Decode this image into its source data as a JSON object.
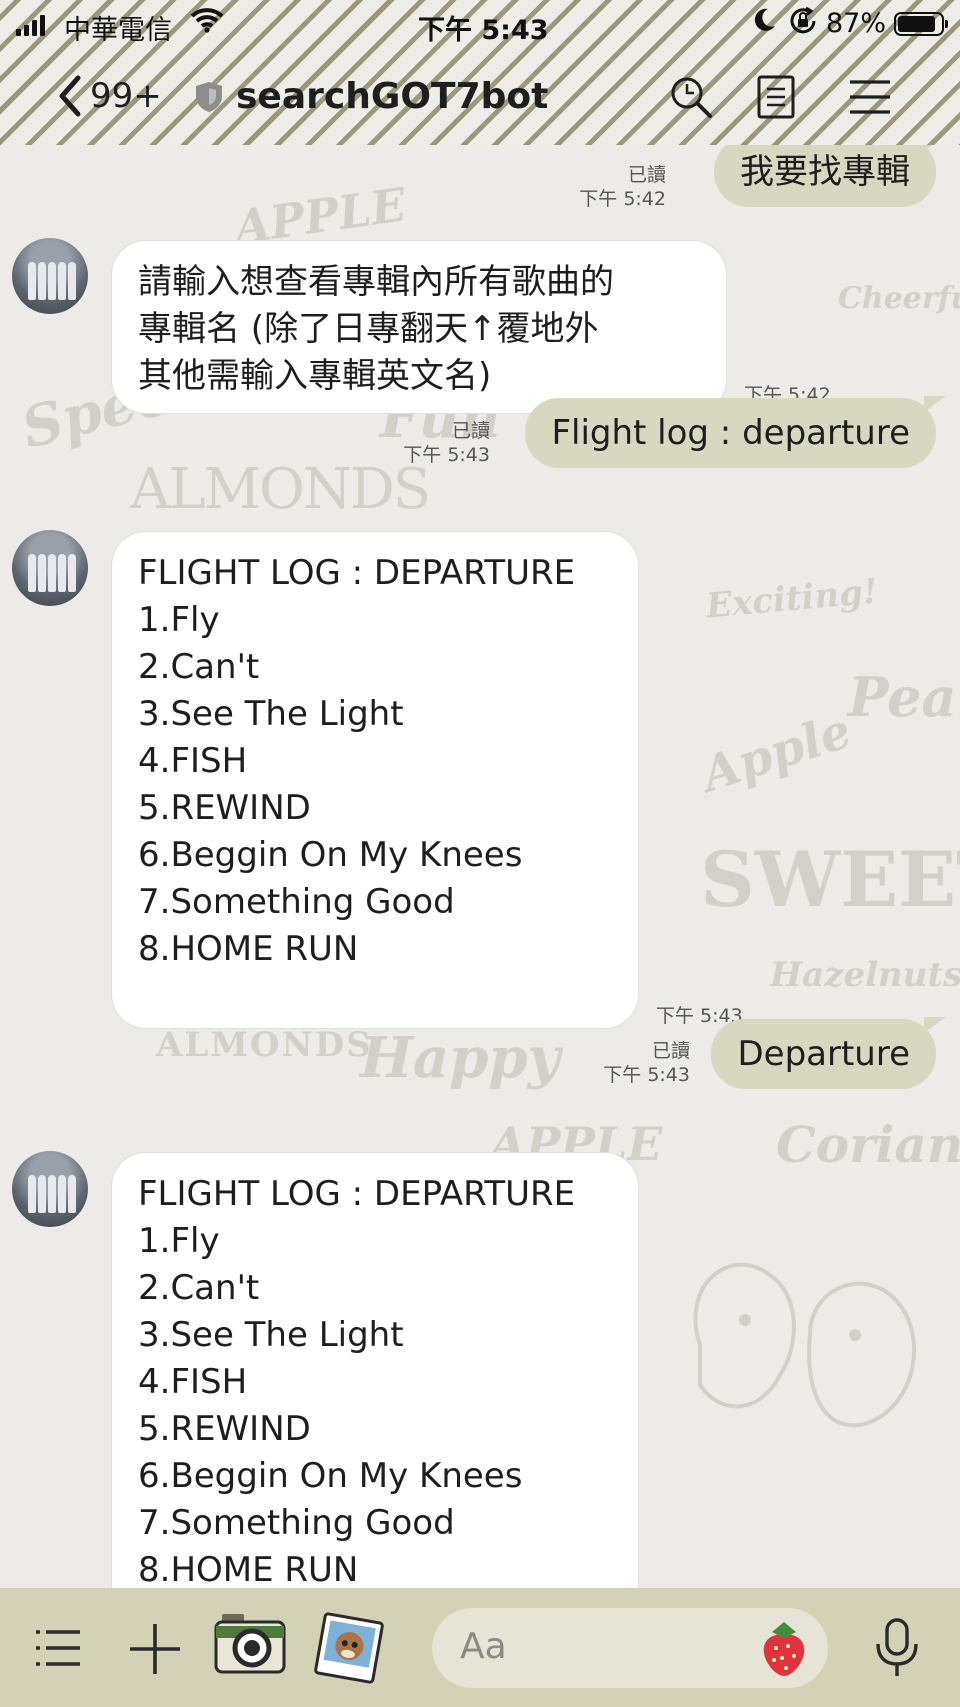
{
  "status_bar": {
    "carrier": "中華電信",
    "time": "下午 5:43",
    "battery": "87%"
  },
  "nav": {
    "back_count": "99+",
    "chat_title": "searchGOT7bot"
  },
  "messages": {
    "m1": {
      "text": "我要找專輯",
      "read": "已讀",
      "time": "下午 5:42"
    },
    "m2": {
      "lines": [
        "請輸入想查看專輯內所有歌曲的",
        "專輯名 (除了日專翻天↑覆地外",
        "其他需輸入專輯英文名)"
      ],
      "time": "下午 5:42"
    },
    "m3": {
      "text": "Flight log : departure",
      "read": "已讀",
      "time": "下午 5:43"
    },
    "m4": {
      "lines": [
        "FLIGHT LOG : DEPARTURE",
        "1.Fly",
        "2.Can't",
        "3.See The Light",
        "4.FISH",
        "5.REWIND",
        "6.Beggin On My Knees",
        "7.Something Good",
        "8.HOME RUN"
      ],
      "time": "下午 5:43"
    },
    "m5": {
      "text": "Departure",
      "read": "已讀",
      "time": "下午 5:43"
    },
    "m6": {
      "lines": [
        "FLIGHT LOG : DEPARTURE",
        "1.Fly",
        "2.Can't",
        "3.See The Light",
        "4.FISH",
        "5.REWIND",
        "6.Beggin On My Knees",
        "7.Something Good",
        "8.HOME RUN"
      ]
    }
  },
  "wallpaper_words": [
    "APPLE",
    "Special",
    "ALMONDS",
    "Exciting!",
    "Pear",
    "Apple",
    "SWEET",
    "Hazelnuts",
    "ALMONDS",
    "Happy",
    "Coriander",
    "APPLE",
    "Cheerful",
    "Fun"
  ],
  "input": {
    "placeholder": "Aa"
  },
  "colors": {
    "outgoing_bubble": "#d8d7c2",
    "incoming_bubble": "#ffffff",
    "bottom_bar": "#d3d1b6"
  },
  "icons": [
    "back-chevron-icon",
    "shield-icon",
    "search-icon",
    "notes-icon",
    "menu-icon",
    "list-icon",
    "plus-icon",
    "camera-icon",
    "photo-icon",
    "strawberry-sticker-icon",
    "microphone-icon"
  ]
}
